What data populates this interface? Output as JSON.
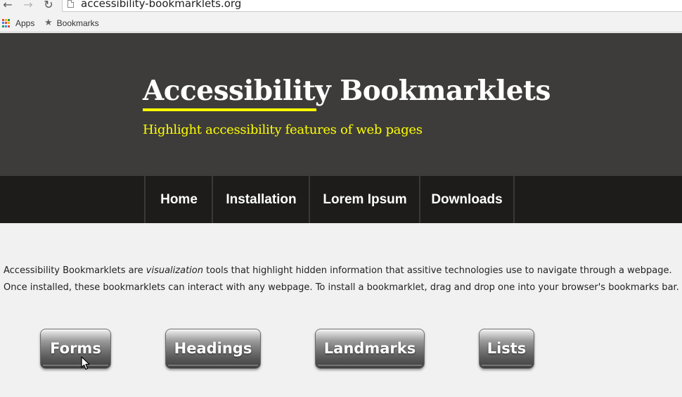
{
  "browser": {
    "url": "accessibility-bookmarklets.org",
    "bookmarks_bar": {
      "apps_label": "Apps",
      "bookmarks_label": "Bookmarks"
    }
  },
  "site": {
    "title": "Accessibility Bookmarklets",
    "tagline": "Highlight accessibility features of web pages",
    "accent_color": "#ffff00",
    "header_bg": "#3d3c3b",
    "nav_bg": "#1d1c1b"
  },
  "nav": {
    "items": [
      {
        "label": "Home"
      },
      {
        "label": "Installation"
      },
      {
        "label": "Lorem Ipsum"
      },
      {
        "label": "Downloads"
      }
    ]
  },
  "intro": {
    "line1_pre": "Accessibility Bookmarklets are ",
    "line1_em": "visualization",
    "line1_post": " tools that highlight hidden information that assitive technologies use to navigate through a webpage.",
    "line2": "Once installed, these bookmarklets can interact with any webpage. To install a bookmarklet, drag and drop one into your browser's bookmarks bar."
  },
  "bookmarklets": [
    {
      "label": "Forms"
    },
    {
      "label": "Headings"
    },
    {
      "label": "Landmarks"
    },
    {
      "label": "Lists"
    }
  ]
}
